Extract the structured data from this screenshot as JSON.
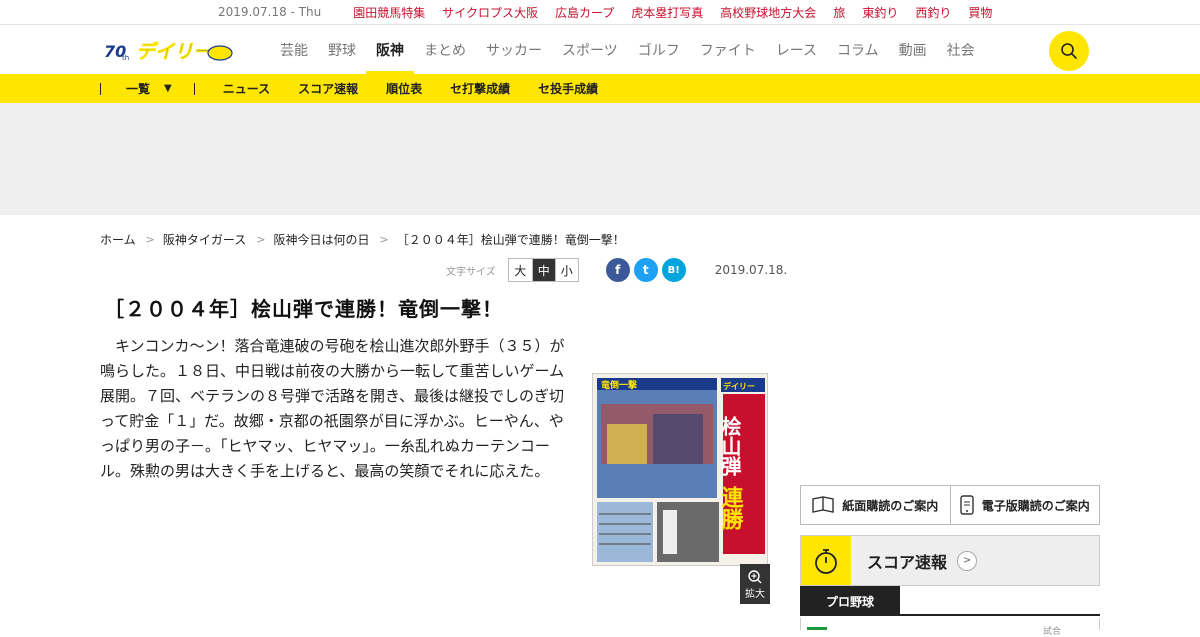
{
  "topbar": {
    "date": "2019.07.18 - Thu",
    "links": [
      "園田競馬特集",
      "サイクロプス大阪",
      "広島カープ",
      "虎本塁打写真",
      "高校野球地方大会",
      "旅",
      "東釣り",
      "西釣り",
      "買物"
    ]
  },
  "header": {
    "logo_text": "デイリー",
    "logo_badge": "70th",
    "nav": [
      "芸能",
      "野球",
      "阪神",
      "まとめ",
      "サッカー",
      "スポーツ",
      "ゴルフ",
      "ファイト",
      "レース",
      "コラム",
      "動画",
      "社会"
    ],
    "active_nav": "阪神"
  },
  "subnav": {
    "dropdown_label": "一覧",
    "items": [
      "ニュース",
      "スコア速報",
      "順位表",
      "セ打撃成績",
      "セ投手成績"
    ]
  },
  "breadcrumb": [
    "ホーム",
    "阪神タイガース",
    "阪神今日は何の日",
    "［２００４年］桧山弾で連勝！竜倒一撃！"
  ],
  "tools": {
    "font_size_label": "文字サイズ",
    "font_sizes": [
      "大",
      "中",
      "小"
    ],
    "selected_font_size": "中",
    "share": [
      "f",
      "t",
      "B!"
    ],
    "date": "2019.07.18."
  },
  "article": {
    "title": "［２００４年］桧山弾で連勝！竜倒一撃！",
    "body": "　キンコンカ～ン！落合竜連破の号砲を桧山進次郎外野手（３５）が鳴らした。１８日、中日戦は前夜の大勝から一転して重苦しいゲーム展開。７回、ベテランの８号弾で活路を開き、最後は継投でしのぎ切って貯金「１」だ。故郷・京都の祇園祭が目に浮かぶ。ヒーやん、やっぱり男の子－。「ヒヤマッ、ヒヤマッ」。一糸乱れぬカーテンコール。殊勲の男は大きく手を上げると、最高の笑顔でそれに応えた。",
    "image_headline_1": "桧山弾",
    "image_headline_2": "連勝",
    "image_banner": "竜倒一撃",
    "image_logo": "デイリー",
    "zoom_label": "拡大"
  },
  "sidebar": {
    "subscribe_paper": "紙面購読のご案内",
    "subscribe_digital": "電子版購読のご案内",
    "score_title": "スコア速報",
    "tab_label": "プロ野球",
    "row_fragment": "試合"
  },
  "colors": {
    "brand_yellow": "#ffe600",
    "link_red": "#c8102e"
  }
}
